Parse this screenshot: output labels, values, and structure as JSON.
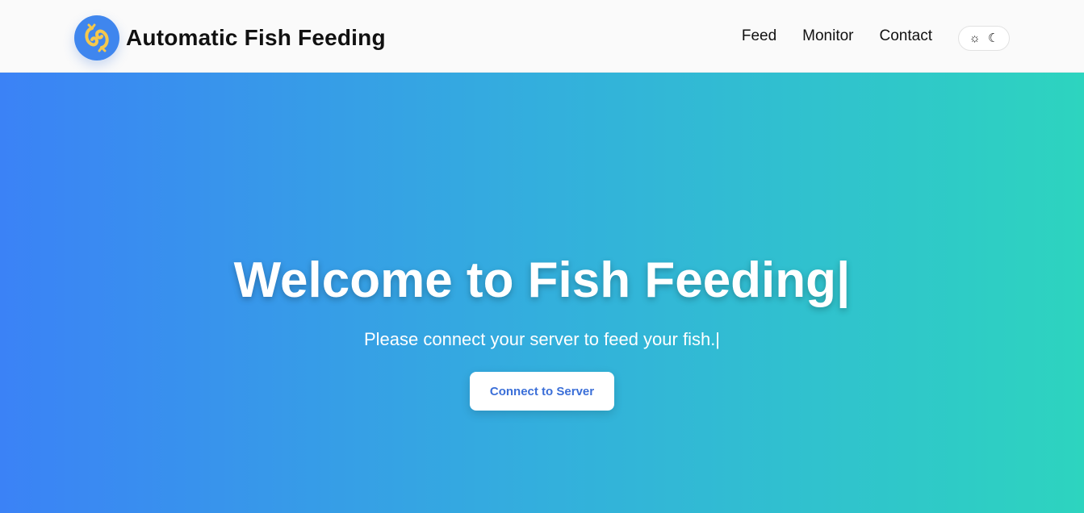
{
  "brand": {
    "title": "Automatic Fish Feeding",
    "logo_icon": "fish-icon",
    "logo_bg": "#3f86ee",
    "fish_color": "#f5c84c"
  },
  "nav": {
    "items": [
      {
        "label": "Feed"
      },
      {
        "label": "Monitor"
      },
      {
        "label": "Contact"
      }
    ]
  },
  "theme_toggle": {
    "light_icon": "☼",
    "dark_icon": "☾"
  },
  "hero": {
    "title": "Welcome to Fish Feeding|",
    "subtitle": "Please connect your server to feed your fish.|",
    "cta_label": "Connect to Server",
    "gradient_start": "#3b82f6",
    "gradient_end": "#2dd4bf"
  }
}
